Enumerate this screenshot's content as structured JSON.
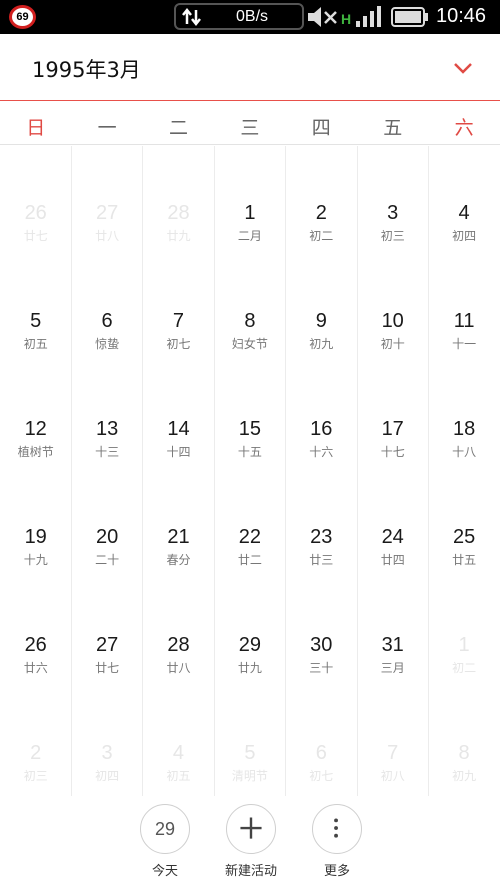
{
  "status_bar": {
    "badge": "69",
    "net_speed": "0B/s",
    "network_type": "H",
    "time": "10:46"
  },
  "header": {
    "title": "1995年3月",
    "dropdown_icon": "chevron-down-icon"
  },
  "weekdays": [
    "日",
    "一",
    "二",
    "三",
    "四",
    "五",
    "六"
  ],
  "weeks": [
    [
      {
        "day": "26",
        "lunar": "廿七",
        "dim": true
      },
      {
        "day": "27",
        "lunar": "廿八",
        "dim": true
      },
      {
        "day": "28",
        "lunar": "廿九",
        "dim": true
      },
      {
        "day": "1",
        "lunar": "二月",
        "dim": false
      },
      {
        "day": "2",
        "lunar": "初二",
        "dim": false
      },
      {
        "day": "3",
        "lunar": "初三",
        "dim": false
      },
      {
        "day": "4",
        "lunar": "初四",
        "dim": false
      }
    ],
    [
      {
        "day": "5",
        "lunar": "初五",
        "dim": false
      },
      {
        "day": "6",
        "lunar": "惊蛰",
        "dim": false
      },
      {
        "day": "7",
        "lunar": "初七",
        "dim": false
      },
      {
        "day": "8",
        "lunar": "妇女节",
        "dim": false
      },
      {
        "day": "9",
        "lunar": "初九",
        "dim": false
      },
      {
        "day": "10",
        "lunar": "初十",
        "dim": false
      },
      {
        "day": "11",
        "lunar": "十一",
        "dim": false
      }
    ],
    [
      {
        "day": "12",
        "lunar": "植树节",
        "dim": false
      },
      {
        "day": "13",
        "lunar": "十三",
        "dim": false
      },
      {
        "day": "14",
        "lunar": "十四",
        "dim": false
      },
      {
        "day": "15",
        "lunar": "十五",
        "dim": false
      },
      {
        "day": "16",
        "lunar": "十六",
        "dim": false
      },
      {
        "day": "17",
        "lunar": "十七",
        "dim": false
      },
      {
        "day": "18",
        "lunar": "十八",
        "dim": false
      }
    ],
    [
      {
        "day": "19",
        "lunar": "十九",
        "dim": false
      },
      {
        "day": "20",
        "lunar": "二十",
        "dim": false
      },
      {
        "day": "21",
        "lunar": "春分",
        "dim": false
      },
      {
        "day": "22",
        "lunar": "廿二",
        "dim": false
      },
      {
        "day": "23",
        "lunar": "廿三",
        "dim": false
      },
      {
        "day": "24",
        "lunar": "廿四",
        "dim": false
      },
      {
        "day": "25",
        "lunar": "廿五",
        "dim": false
      }
    ],
    [
      {
        "day": "26",
        "lunar": "廿六",
        "dim": false
      },
      {
        "day": "27",
        "lunar": "廿七",
        "dim": false
      },
      {
        "day": "28",
        "lunar": "廿八",
        "dim": false
      },
      {
        "day": "29",
        "lunar": "廿九",
        "dim": false
      },
      {
        "day": "30",
        "lunar": "三十",
        "dim": false
      },
      {
        "day": "31",
        "lunar": "三月",
        "dim": false
      },
      {
        "day": "1",
        "lunar": "初二",
        "dim": true
      }
    ],
    [
      {
        "day": "2",
        "lunar": "初三",
        "dim": true
      },
      {
        "day": "3",
        "lunar": "初四",
        "dim": true
      },
      {
        "day": "4",
        "lunar": "初五",
        "dim": true
      },
      {
        "day": "5",
        "lunar": "清明节",
        "dim": true
      },
      {
        "day": "6",
        "lunar": "初七",
        "dim": true
      },
      {
        "day": "7",
        "lunar": "初八",
        "dim": true
      },
      {
        "day": "8",
        "lunar": "初九",
        "dim": true
      }
    ]
  ],
  "bottom_bar": {
    "today": {
      "number": "29",
      "label": "今天"
    },
    "new_event": {
      "label": "新建活动",
      "icon": "plus-icon"
    },
    "more": {
      "label": "更多",
      "icon": "more-vertical-icon"
    }
  },
  "colors": {
    "accent": "#e04a44",
    "divider": "#ececec"
  }
}
